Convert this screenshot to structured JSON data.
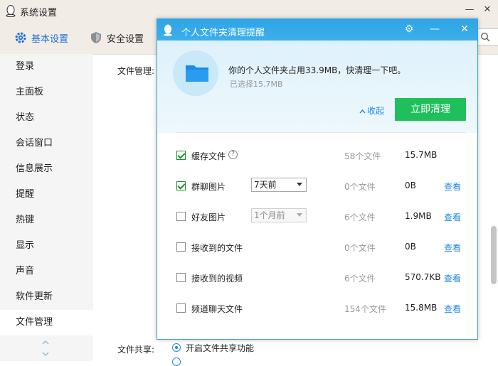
{
  "window": {
    "title": "系统设置",
    "controls": {
      "minimize": "—",
      "close": "✕"
    }
  },
  "toolbar": {
    "tabs": [
      {
        "label": "基本设置",
        "icon": "gear-icon",
        "active": true
      },
      {
        "label": "安全设置",
        "icon": "shield-icon",
        "active": false
      }
    ]
  },
  "sidebar": {
    "items": [
      {
        "label": "登录"
      },
      {
        "label": "主面板"
      },
      {
        "label": "状态"
      },
      {
        "label": "会话窗口"
      },
      {
        "label": "信息展示"
      },
      {
        "label": "提醒"
      },
      {
        "label": "热键"
      },
      {
        "label": "显示"
      },
      {
        "label": "声音"
      },
      {
        "label": "软件更新"
      },
      {
        "label": "文件管理",
        "active": true
      }
    ]
  },
  "content": {
    "file_management_label": "文件管理:",
    "file_sharing_label": "文件共享:",
    "share_option_on": "开启文件共享功能",
    "share_option_on_selected": true
  },
  "dialog": {
    "title": "个人文件夹清理提醒",
    "controls": {
      "settings": "⚙",
      "minimize": "—",
      "close": "✕"
    },
    "message": "你的个人文件夹占用33.9MB，快清理一下吧。",
    "selected": "已选择15.7MB",
    "collapse_label": "收起",
    "clean_button": "立即清理",
    "rows": [
      {
        "label": "缓存文件",
        "checked": true,
        "help": "?",
        "count": "58个文件",
        "size": "15.7MB",
        "view": ""
      },
      {
        "label": "群聊图片",
        "checked": true,
        "select": "7天前",
        "count": "0个文件",
        "size": "0B",
        "view": "查看"
      },
      {
        "label": "好友图片",
        "checked": false,
        "select": "1个月前",
        "count": "6个文件",
        "size": "1.9MB",
        "view": "查看"
      },
      {
        "label": "接收到的文件",
        "checked": false,
        "count": "0个文件",
        "size": "0B",
        "view": "查看"
      },
      {
        "label": "接收到的视频",
        "checked": false,
        "count": "6个文件",
        "size": "570.7KB",
        "view": "查看"
      },
      {
        "label": "频道聊天文件",
        "checked": false,
        "count": "154个文件",
        "size": "15.8MB",
        "view": "查看"
      }
    ]
  },
  "colors": {
    "accent": "#1d87e5",
    "clean_button": "#1fc05b",
    "dialog_titlebar": "#2ea5e6",
    "check": "#1c8f2e"
  }
}
